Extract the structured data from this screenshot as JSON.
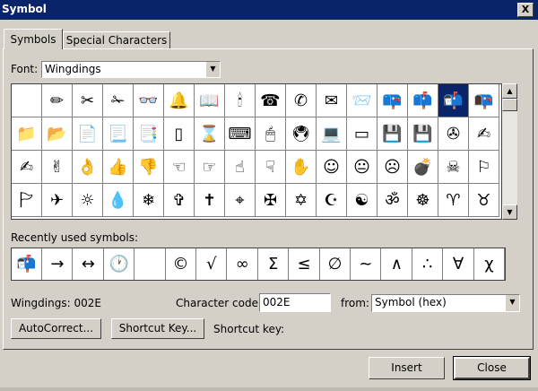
{
  "window": {
    "title": "Symbol",
    "close_label": "X"
  },
  "tabs": [
    {
      "label": "Symbols",
      "active": true
    },
    {
      "label": "Special Characters",
      "active": false
    }
  ],
  "font": {
    "label": "Font:",
    "value": "Wingdings"
  },
  "symbols": [
    "",
    "✏",
    "✂",
    "✁",
    "👓",
    "🔔",
    "📖",
    "🕯",
    "☎",
    "✆",
    "✉",
    "📨",
    "📪",
    "📫",
    "📬",
    "📭",
    "📁",
    "📂",
    "📄",
    "📃",
    "📑",
    "▯",
    "⌛",
    "⌨",
    "🖱",
    "🖲",
    "💻",
    "▭",
    "💾",
    "💾",
    "✇",
    "✍",
    "✍",
    "✌",
    "👌",
    "👍",
    "👎",
    "☜",
    "☞",
    "☝",
    "☟",
    "✋",
    "☺",
    "😐",
    "☹",
    "💣",
    "☠",
    "⚐",
    "🏱",
    "✈",
    "☼",
    "💧",
    "❄",
    "✞",
    "✝",
    "⌖",
    "✠",
    "✡",
    "☪",
    "☯",
    "ॐ",
    "☸",
    "♈",
    "♉"
  ],
  "selected_index": 14,
  "recent": {
    "label": "Recently used symbols:",
    "items": [
      "📬",
      "→",
      "↔",
      "🕐",
      "",
      "©",
      "√",
      "∞",
      "Σ",
      "≤",
      "∅",
      "~",
      "∧",
      "∴",
      "∀",
      "χ"
    ]
  },
  "char_name": "Wingdings: 002E",
  "char_code": {
    "label": "Character code:",
    "value": "002E"
  },
  "from": {
    "label": "from:",
    "value": "Symbol (hex)"
  },
  "buttons": {
    "autocorrect": "AutoCorrect...",
    "shortcut_key": "Shortcut Key...",
    "insert": "Insert",
    "close": "Close"
  },
  "shortcut_label": "Shortcut key:",
  "icons": {
    "dropdown": "dropdown-arrow-icon",
    "scroll_up": "scroll-up-icon",
    "scroll_down": "scroll-down-icon"
  }
}
